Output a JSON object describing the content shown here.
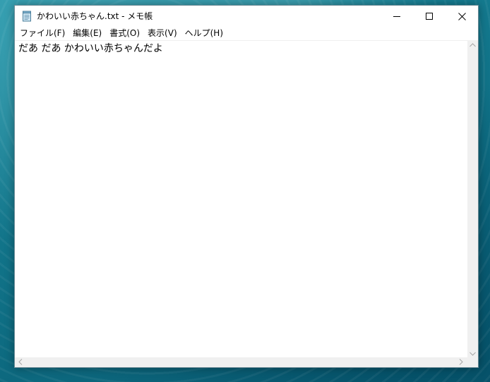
{
  "window": {
    "title": "かわいい赤ちゃん.txt - メモ帳"
  },
  "icons": {
    "app": "notepad-icon",
    "minimize": "minimize-icon",
    "maximize": "maximize-icon",
    "close": "close-icon"
  },
  "menu": {
    "items": [
      {
        "label": "ファイル(F)"
      },
      {
        "label": "編集(E)"
      },
      {
        "label": "書式(O)"
      },
      {
        "label": "表示(V)"
      },
      {
        "label": "ヘルプ(H)"
      }
    ]
  },
  "editor": {
    "content": "だあ だあ かわいい赤ちゃんだよ"
  },
  "colors": {
    "window_bg": "#ffffff",
    "scrollbar_bg": "#f0f0f0",
    "desktop": "#13788d"
  }
}
